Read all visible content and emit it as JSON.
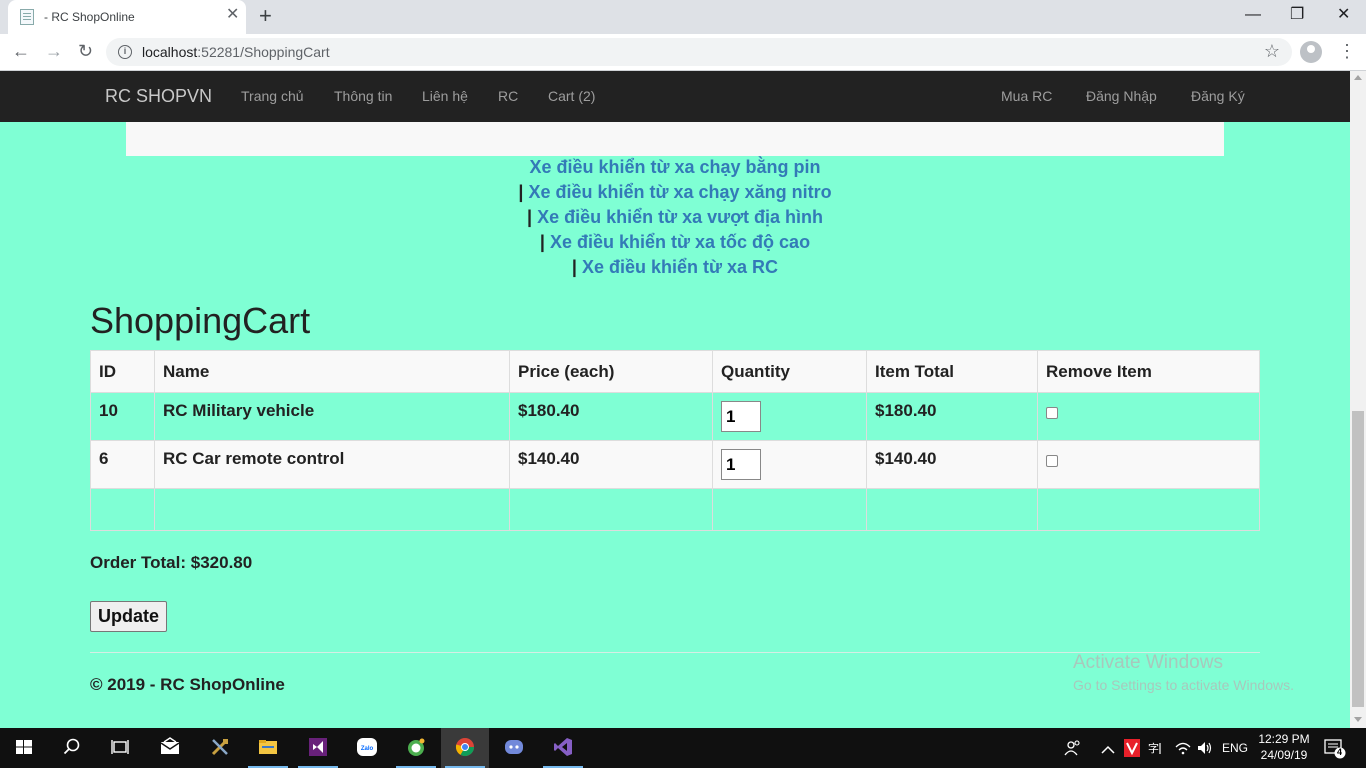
{
  "browser": {
    "tab_title": "- RC ShopOnline",
    "tab_close": "✕",
    "new_tab": "+",
    "minimize": "—",
    "restore": "❐",
    "close": "✕",
    "url_host": "localhost",
    "url_rest": ":52281/ShoppingCart",
    "back": "←",
    "forward": "→",
    "reload": "↻",
    "star": "☆",
    "menu": "⋮"
  },
  "navbar": {
    "brand": "RC SHOPVN",
    "left_links": [
      "Trang chủ",
      "Thông tin",
      "Liên hệ",
      "RC",
      "Cart (2)"
    ],
    "right_links": [
      "Mua RC",
      "Đăng Nhập",
      "Đăng Ký"
    ]
  },
  "categories": [
    {
      "prefix": "",
      "label": "Xe điều khiển từ xa chạy bằng pin"
    },
    {
      "prefix": "| ",
      "label": "Xe điều khiển từ xa chạy xăng nitro"
    },
    {
      "prefix": "| ",
      "label": "Xe điều khiển từ xa vượt địa hình"
    },
    {
      "prefix": "| ",
      "label": "Xe điều khiển từ xa tốc độ cao"
    },
    {
      "prefix": "| ",
      "label": "Xe điều khiển từ xa RC"
    }
  ],
  "cart": {
    "title": "ShoppingCart",
    "headers": [
      "ID",
      "Name",
      "Price (each)",
      "Quantity",
      "Item Total",
      "Remove Item"
    ],
    "rows": [
      {
        "id": "10",
        "name": "RC Military vehicle",
        "price": "$180.40",
        "quantity": "1",
        "total": "$180.40",
        "remove": false
      },
      {
        "id": "6",
        "name": "RC Car remote control",
        "price": "$140.40",
        "quantity": "1",
        "total": "$140.40",
        "remove": false
      }
    ],
    "order_total": "Order Total: $320.80",
    "update_label": "Update"
  },
  "footer": {
    "copyright": "© 2019 - RC ShopOnline"
  },
  "watermark": {
    "line1": "Activate Windows",
    "line2": "Go to Settings to activate Windows."
  },
  "taskbar": {
    "apps": [
      "windows-start-icon",
      "search-icon",
      "task-view-icon",
      "mail-icon",
      "tools-icon",
      "file-explorer-icon",
      "visual-studio-icon",
      "zalo-icon",
      "app-green-icon",
      "chrome-icon",
      "discord-icon",
      "visual-studio-preview-icon"
    ],
    "zalo_label": "Zalo",
    "lang": "ENG",
    "time": "12:29 PM",
    "date": "24/09/19",
    "notification_count": "4"
  }
}
